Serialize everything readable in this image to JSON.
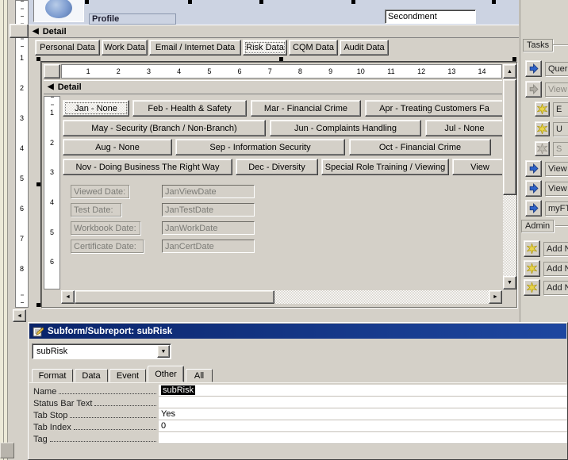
{
  "colors": {
    "titlebar_blue": "#0a246a",
    "header_strip_blue": "#ccd3e2",
    "design_gray": "#d4d0c8",
    "selection_black": "#000000",
    "arrow_icon_blue": "#2f63c9",
    "star_icon_gold": "#e8d44c"
  },
  "form_header": {
    "profile_label": "Profile",
    "secondment_value": "Secondment"
  },
  "outer_section": {
    "detail_label": "Detail",
    "arrow": "◀"
  },
  "main_tabs": [
    "Personal Data",
    "Work Data",
    "Email / Internet Data",
    "Risk Data",
    "CQM Data",
    "Audit Data"
  ],
  "rulers": {
    "outer_vertical": [
      "1",
      "2",
      "3",
      "4",
      "5",
      "6",
      "7",
      "8"
    ],
    "subform_horizontal": [
      "1",
      "2",
      "3",
      "4",
      "5",
      "6",
      "7",
      "8",
      "9",
      "10",
      "11",
      "12",
      "13",
      "14"
    ],
    "subform_vertical": [
      "1",
      "2",
      "3",
      "4",
      "5",
      "6"
    ]
  },
  "subform": {
    "detail_label": "Detail",
    "arrow": "◀",
    "month_rows": [
      [
        "Jan - None",
        "Feb - Health & Safety",
        "Mar - Financial Crime",
        "Apr - Treating Customers Fa"
      ],
      [
        "May - Security (Branch / Non-Branch)",
        "Jun - Complaints Handling",
        "Jul - None"
      ],
      [
        "Aug - None",
        "Sep - Information Security",
        "Oct - Financial Crime"
      ],
      [
        "Nov - Doing Business The Right Way",
        "Dec - Diversity",
        "Special Role Training / Viewing",
        "View"
      ]
    ],
    "fields": [
      {
        "label": "Viewed Date:",
        "value": "JanViewDate"
      },
      {
        "label": "Test Date:",
        "value": "JanTestDate"
      },
      {
        "label": "Workbook Date:",
        "value": "JanWorkDate"
      },
      {
        "label": "Certificate Date:",
        "value": "JanCertDate"
      }
    ]
  },
  "scroll": {
    "up": "▲",
    "down": "▼",
    "left": "◄",
    "right": "►"
  },
  "sidebar": {
    "tasks_label": "Tasks",
    "admin_label": "Admin",
    "task_items": [
      "Quer",
      "View",
      "E",
      "U",
      "S",
      "View",
      "View",
      "myFT"
    ],
    "admin_items": [
      "Add N",
      "Add N",
      "Add N"
    ]
  },
  "property_sheet": {
    "title": "Subform/Subreport: subRisk",
    "selector_value": "subRisk",
    "dropdown_glyph": "▼",
    "tabs": [
      "Format",
      "Data",
      "Event",
      "Other",
      "All"
    ],
    "rows": [
      {
        "label": "Name",
        "value": "subRisk"
      },
      {
        "label": "Status Bar Text",
        "value": ""
      },
      {
        "label": "Tab Stop",
        "value": "Yes"
      },
      {
        "label": "Tab Index",
        "value": "0"
      },
      {
        "label": "Tag",
        "value": ""
      }
    ]
  }
}
